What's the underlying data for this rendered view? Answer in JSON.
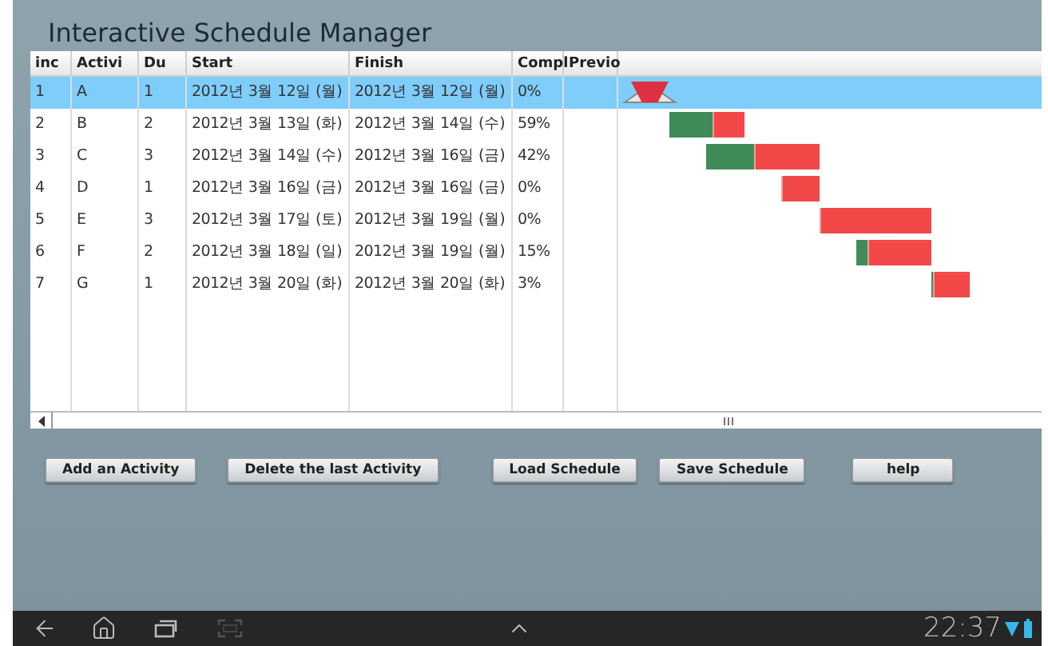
{
  "app": {
    "title": "Interactive Schedule Manager"
  },
  "table": {
    "columns": [
      "inc",
      "Activi",
      "Du",
      "Start",
      "Finish",
      "Compl",
      "Previo"
    ],
    "rows": [
      {
        "index": "1",
        "activity": "A",
        "duration": "1",
        "start": "2012년 3월 12일 (월)",
        "finish": "2012년 3월 12일 (월)",
        "complete": "0%",
        "selected": true
      },
      {
        "index": "2",
        "activity": "B",
        "duration": "2",
        "start": "2012년 3월 13일 (화)",
        "finish": "2012년 3월 14일 (수)",
        "complete": "59%",
        "level": 0.59,
        "selected": false
      },
      {
        "index": "3",
        "activity": "C",
        "duration": "3",
        "start": "2012년 3월 14일 (수)",
        "finish": "2012년 3월 16일 (금)",
        "complete": "42%",
        "level": 0.42,
        "selected": false
      },
      {
        "index": "4",
        "activity": "D",
        "duration": "1",
        "start": "2012년 3월 16일 (금)",
        "finish": "2012년 3월 16일 (금)",
        "complete": "0%",
        "selected": false
      },
      {
        "index": "5",
        "activity": "E",
        "duration": "3",
        "start": "2012년 3월 17일 (토)",
        "finish": "2012년 3월 19일 (월)",
        "complete": "0%",
        "selected": false
      },
      {
        "index": "6",
        "activity": "F",
        "duration": "2",
        "start": "2012년 3월 18일 (일)",
        "finish": "2012년 3월 19일 (월)",
        "complete": "15%",
        "level": 0.15,
        "selected": false
      },
      {
        "index": "7",
        "activity": "G",
        "duration": "1",
        "start": "2012년 3월 20일 (화)",
        "finish": "2012년 3월 20일 (화)",
        "complete": "3%",
        "level": 0.03,
        "selected": false
      }
    ]
  },
  "buttons": [
    "Add an Activity",
    "Delete the last Activity",
    "Load Schedule",
    "Save Schedule",
    "help"
  ],
  "status_bar": {
    "time": "22:37"
  }
}
